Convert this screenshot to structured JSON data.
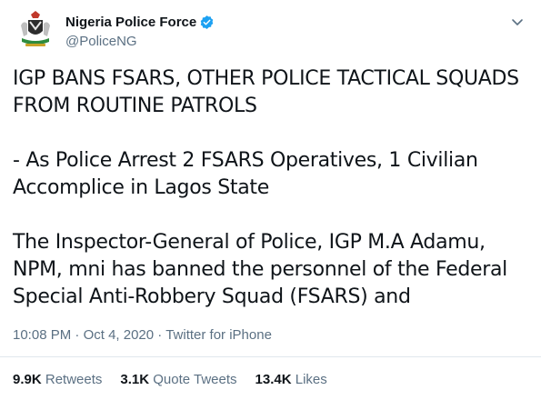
{
  "author": {
    "display_name": "Nigeria Police Force",
    "handle": "@PoliceNG",
    "avatar_icon": "police-crest-icon",
    "verified_icon": "verified-badge-icon",
    "verified_color": "#1da1f2"
  },
  "tweet": {
    "paragraphs": [
      "IGP BANS FSARS, OTHER POLICE TACTICAL SQUADS FROM ROUTINE PATROLS",
      "- As Police Arrest 2 FSARS Operatives, 1 Civilian Accomplice in Lagos State",
      "The Inspector-General of Police, IGP M.A Adamu, NPM, mni has banned the personnel of the Federal Special Anti-Robbery Squad (FSARS) and"
    ],
    "time": "10:08 PM",
    "separator": "·",
    "date": "Oct 4, 2020",
    "source": "Twitter for iPhone"
  },
  "stats": {
    "retweets_count": "9.9K",
    "retweets_label": "Retweets",
    "quotes_count": "3.1K",
    "quotes_label": "Quote Tweets",
    "likes_count": "13.4K",
    "likes_label": "Likes"
  },
  "menu_icon": "chevron-down-icon",
  "colors": {
    "text": "#0f1419",
    "secondary": "#5b7083",
    "divider": "#e1e8ed"
  }
}
